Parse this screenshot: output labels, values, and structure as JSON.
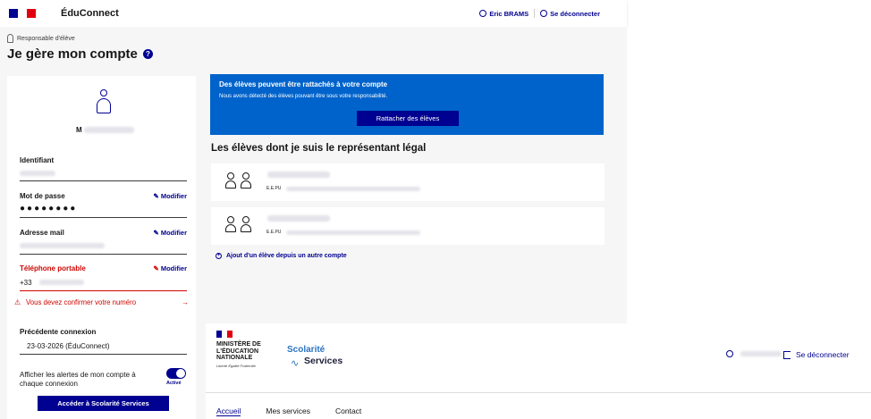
{
  "header": {
    "brand": "ÉduConnect",
    "user_name": "Eric BRAMS",
    "logout": "Se déconnecter"
  },
  "colors": {
    "flag_blue": "#000091",
    "flag_white": "#ffffff",
    "flag_red": "#e1000f",
    "accent": "#000091",
    "info_blue": "#0063cb",
    "error": "#ce0500"
  },
  "page": {
    "role": "Responsable d'élève",
    "title": "Je gère mon compte"
  },
  "profile": {
    "initial": "M"
  },
  "fields": {
    "id_label": "Identifiant",
    "pwd_label": "Mot de passe",
    "pwd_value": "●●●●●●●●",
    "modify": "Modifier",
    "mail_label": "Adresse mail",
    "phone_label": "Téléphone portable",
    "phone_prefix": "+33",
    "phone_error": "Vous devez confirmer votre numéro",
    "prev_label": "Précédente connexion",
    "prev_value": "23-03-2026 (ÉduConnect)",
    "alerts_label": "Afficher les alertes de mon compte à chaque connexion",
    "alerts_state": "Activé",
    "scolarite_button": "Accéder à Scolarité Services"
  },
  "attach": {
    "title": "Des élèves peuvent être rattachés à votre compte",
    "subtitle": "Nous avons détecté des élèves pouvant être sous votre responsabilité.",
    "button": "Rattacher des élèves"
  },
  "students": {
    "title": "Les élèves dont je suis le représentant légal",
    "items": [
      {
        "school_prefix": "E.E.PU"
      },
      {
        "school_prefix": "E.E.PU"
      }
    ],
    "add_link": "Ajout d'un élève depuis un autre compte"
  },
  "footer": {
    "ministry": "MINISTÈRE DE L'ÉDUCATION NATIONALE",
    "motto": "Liberté Égalité Fraternité",
    "logo_top": "Scolarité",
    "logo_bottom": "Services",
    "logout": "Se déconnecter",
    "nav": [
      "Accueil",
      "Mes services",
      "Contact"
    ]
  }
}
